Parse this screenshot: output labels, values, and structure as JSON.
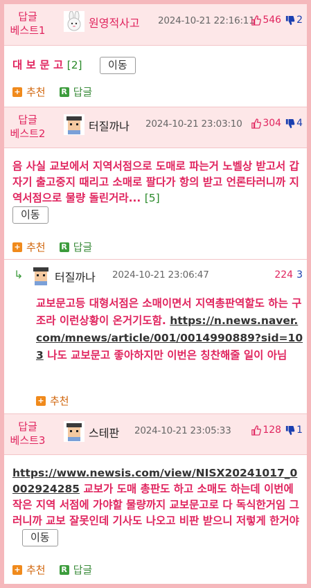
{
  "best1": {
    "badge_line1": "답글",
    "badge_line2": "베스트1",
    "nick": "원영적사고",
    "date": "2024-10-21 22:16:11",
    "up": "546",
    "down": "2",
    "text": "대 보 문 고",
    "reply_count": "[2]",
    "move_label": "이동",
    "recommend_label": "추천",
    "reply_label": "답글"
  },
  "best2": {
    "badge_line1": "답글",
    "badge_line2": "베스트2",
    "nick": "터질까나",
    "date": "2024-10-21 23:03:10",
    "up": "304",
    "down": "4",
    "text": "음 사실 교보에서 지역서점으로 도매로 파는거 노벨상 받고서 갑자기 출고중지 때리고 소매로 팔다가 항의 받고 언론타러니까 지역서점으로 물량 돌린거라...",
    "reply_count": "[5]",
    "move_label": "이동",
    "recommend_label": "추천",
    "reply_label": "답글"
  },
  "subreply": {
    "nick": "터질까나",
    "date": "2024-10-21 23:06:47",
    "up": "224",
    "down": "3",
    "text_before": "교보문고등 대형서점은 소매이면서 지역총판역할도 하는 구조라 이런상황이 온거기도함.",
    "link": "https://n.news.naver.com/mnews/article/001/0014990889?sid=103",
    "text_after": "나도 교보문고 좋아하지만 이번은 칭찬해줄 일이 아님",
    "recommend_label": "추천"
  },
  "best3": {
    "badge_line1": "답글",
    "badge_line2": "베스트3",
    "nick": "스테판",
    "date": "2024-10-21 23:05:33",
    "up": "128",
    "down": "1",
    "link": "https://www.newsis.com/view/NISX20241017_0002924285",
    "text": "교보가 도매 총판도 하고 소매도 하는데 이번에 작은 지역 서점에 가야할 물량까지 교보문고로 다 독식한거임 그러니까 교보 잘못인데 기사도 나오고 비판 받으니 저렇게 한거야",
    "move_label": "이동",
    "recommend_label": "추천",
    "reply_label": "답글"
  },
  "colors": {
    "accent": "#e0245e",
    "header_bg": "#fde7e8",
    "frame": "#f5b8bc",
    "down": "#1a3fb0"
  },
  "icons": [
    "avatar-rabbit-icon",
    "avatar-pixel-icon",
    "thumbs-up-icon",
    "thumbs-down-icon",
    "plus-icon",
    "reply-r-icon",
    "reply-arrow-icon"
  ]
}
